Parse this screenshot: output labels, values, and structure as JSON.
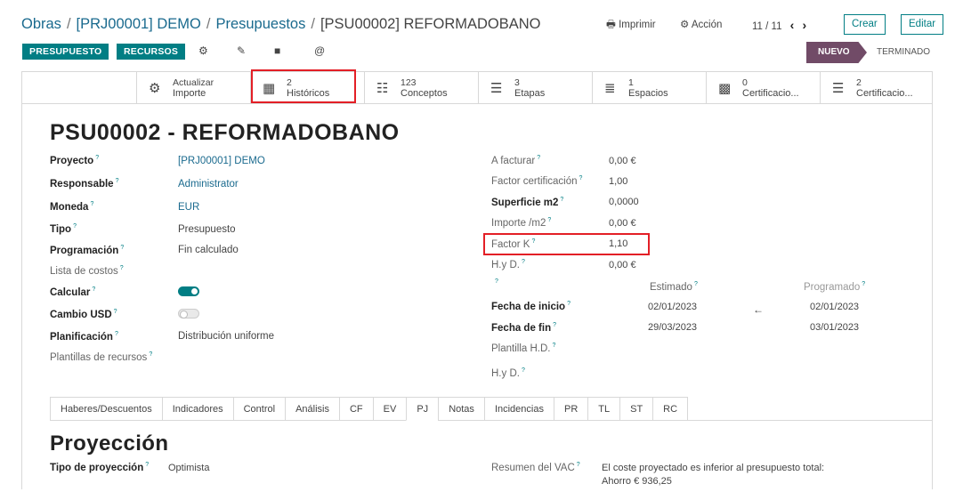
{
  "breadcrumb": [
    "Obras",
    "[PRJ00001] DEMO",
    "Presupuestos",
    "[PSU00002] REFORMADOBANO"
  ],
  "actions": {
    "print": "Imprimir",
    "action": "Acción",
    "pager": "11 / 11",
    "create": "Crear",
    "edit": "Editar"
  },
  "sub_buttons": [
    "PRESUPUESTO",
    "RECURSOS"
  ],
  "status": {
    "current": "NUEVO",
    "next": "TERMINADO"
  },
  "stat_buttons": [
    {
      "line1": "Actualizar",
      "line2": "Importe",
      "icon": "gear-icon"
    },
    {
      "line1": "2",
      "line2": "Históricos",
      "icon": "calendar-icon"
    },
    {
      "line1": "123",
      "line2": "Conceptos",
      "icon": "sitemap-icon"
    },
    {
      "line1": "3",
      "line2": "Etapas",
      "icon": "list-icon"
    },
    {
      "line1": "1",
      "line2": "Espacios",
      "icon": "server-icon"
    },
    {
      "line1": "0",
      "line2": "Certificacio...",
      "icon": "grid-icon"
    },
    {
      "line1": "2",
      "line2": "Certificacio...",
      "icon": "list-icon"
    }
  ],
  "record_title": "PSU00002 - REFORMADOBANO",
  "left_fields": [
    {
      "label": "Proyecto",
      "value": "[PRJ00001] DEMO"
    },
    {
      "label": "Responsable",
      "value": "Administrator"
    },
    {
      "label": "Moneda",
      "value": "EUR"
    },
    {
      "label": "Tipo",
      "value": "Presupuesto"
    },
    {
      "label": "Programación",
      "value": "Fin calculado"
    },
    {
      "label": "Lista de costos",
      "value": ""
    },
    {
      "label": "Calcular",
      "value": ""
    },
    {
      "label": "Cambio USD",
      "value": ""
    },
    {
      "label": "Planificación",
      "value": "Distribución uniforme"
    },
    {
      "label": "Plantillas de recursos",
      "value": ""
    }
  ],
  "toggles": {
    "calcular": true,
    "cambio_usd": false
  },
  "right_fields": [
    {
      "label": "A facturar",
      "value": "0,00 €"
    },
    {
      "label": "Factor certificación",
      "value": "1,00"
    },
    {
      "label": "Superficie m2",
      "value": "0,0000"
    },
    {
      "label": "Importe /m2",
      "value": "0,00 €"
    },
    {
      "label": "Factor K",
      "value": "1,10"
    },
    {
      "label": "H.y D.",
      "value": "0,00 €"
    }
  ],
  "dates": {
    "col_estimado": "Estimado",
    "col_programado": "Programado",
    "start_label": "Fecha de inicio",
    "end_label": "Fecha de fin",
    "start_estimado": "02/01/2023",
    "start_programado": "02/01/2023",
    "end_estimado": "29/03/2023",
    "end_programado": "03/01/2023",
    "plantilla_label": "Plantilla H.D.",
    "hyd_label": "H.y D."
  },
  "tabs": [
    "Haberes/Descuentos",
    "Indicadores",
    "Control",
    "Análisis",
    "CF",
    "EV",
    "PJ",
    "Notas",
    "Incidencias",
    "PR",
    "TL",
    "ST",
    "RC"
  ],
  "active_tab": "PJ",
  "section": {
    "title": "Proyección",
    "tipo_label": "Tipo de proyección",
    "tipo_value": "Optimista",
    "vac_label": "Resumen del VAC",
    "vac_line1": "El coste proyectado es inferior al presupuesto total:",
    "vac_line2": "Ahorro € 936,25"
  }
}
